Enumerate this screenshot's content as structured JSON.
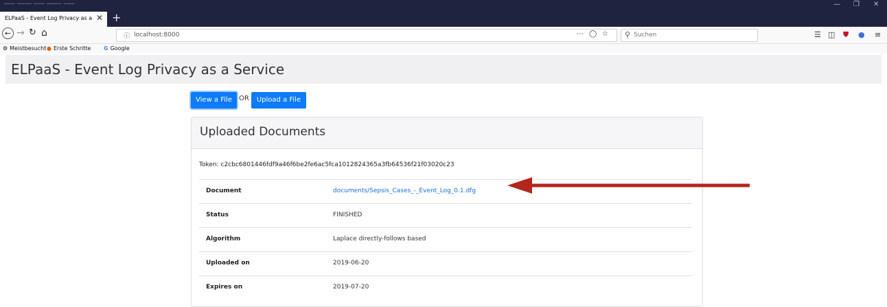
{
  "browser": {
    "tab_title": "ELPaaS - Event Log Privacy as a Ser",
    "url": "localhost:8000",
    "search_placeholder": "Suchen",
    "bookmarks": [
      {
        "label": "Meistbesucht"
      },
      {
        "label": "Erste Schritte"
      },
      {
        "label": "Google"
      }
    ]
  },
  "page": {
    "title": "ELPaaS - Event Log Privacy as a Service",
    "view_button": "View a File",
    "or_text": "OR",
    "upload_button": "Upload a File",
    "card_title": "Uploaded Documents",
    "token_text": "Token: c2cbc6801446fdf9a46f6be2fe6ac5fca1012824365a3fb64536f21f03020c23",
    "rows": [
      {
        "label": "Document",
        "value": "documents/Sepsis_Cases_-_Event_Log_0.1.dfg"
      },
      {
        "label": "Status",
        "value": "FINISHED"
      },
      {
        "label": "Algorithm",
        "value": "Laplace directly-follows based"
      },
      {
        "label": "Uploaded on",
        "value": "2019-06-20"
      },
      {
        "label": "Expires on",
        "value": "2019-07-20"
      }
    ]
  },
  "colors": {
    "primary_button": "#0d7bfa",
    "link": "#1a6fd6",
    "annotation_arrow": "#b3261e",
    "browser_chrome": "#202340"
  }
}
